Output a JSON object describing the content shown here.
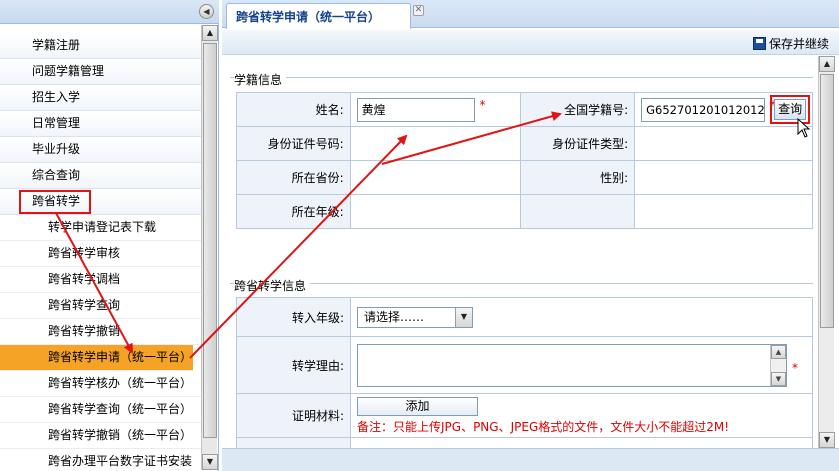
{
  "sidebar": {
    "collapse_icon": "double-chevron-left-icon",
    "items": [
      {
        "label": "学籍注册"
      },
      {
        "label": "问题学籍管理"
      },
      {
        "label": "招生入学"
      },
      {
        "label": "日常管理"
      },
      {
        "label": "毕业升级"
      },
      {
        "label": "综合查询"
      },
      {
        "label": "跨省转学"
      }
    ],
    "sub_items": [
      {
        "label": "转学申请登记表下载"
      },
      {
        "label": "跨省转学审核"
      },
      {
        "label": "跨省转学调档"
      },
      {
        "label": "跨省转学查询"
      },
      {
        "label": "跨省转学撤销"
      },
      {
        "label": "跨省转学申请（统一平台）"
      },
      {
        "label": "跨省转学核办（统一平台）"
      },
      {
        "label": "跨省转学查询（统一平台）"
      },
      {
        "label": "跨省转学撤销（统一平台）"
      },
      {
        "label": "跨省办理平台数字证书安装"
      }
    ]
  },
  "tab": {
    "title": "跨省转学申请（统一平台）",
    "close_icon": "close-icon"
  },
  "toolbar": {
    "save_label": "保存并继续",
    "save_icon": "floppy-disk-icon"
  },
  "section1": {
    "legend": "学籍信息",
    "name_label": "姓名:",
    "name_value": "黄煌",
    "national_id_label": "全国学籍号:",
    "national_id_value": "G652701201012012",
    "query_label": "查询",
    "id_no_label": "身份证件号码:",
    "id_type_label": "身份证件类型:",
    "province_label": "所在省份:",
    "gender_label": "性别:",
    "grade_label": "所在年级:"
  },
  "section2": {
    "legend": "跨省转学信息",
    "grade_label": "转入年级:",
    "grade_select": "请选择……",
    "reason_label": "转学理由:",
    "material_label": "证明材料:",
    "add_label": "添加",
    "note": "备注：只能上传JPG、PNG、JPEG格式的文件，文件大小不能超过2M!"
  },
  "required_mark": "*",
  "colors": {
    "annotation": "#e01414",
    "active_nav": "#f5a327",
    "header_text": "#15428b"
  }
}
